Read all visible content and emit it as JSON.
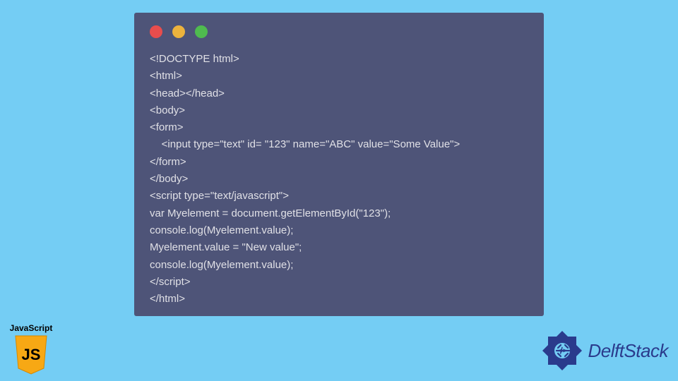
{
  "code_lines": [
    "<!DOCTYPE html>",
    "<html>",
    "<head></head>",
    "<body>",
    "<form>",
    "    <input type=\"text\" id= \"123\" name=\"ABC\" value=\"Some Value\">",
    "</form>",
    "</body>",
    "<script type=\"text/javascript\">",
    "var Myelement = document.getElementById(\"123\");",
    "console.log(Myelement.value);",
    "Myelement.value = \"New value\";",
    "console.log(Myelement.value);",
    "</script>",
    "</html>"
  ],
  "js_badge": {
    "label": "JavaScript",
    "logo_text": "JS"
  },
  "delft": {
    "text": "DelftStack"
  },
  "colors": {
    "bg": "#74cdf4",
    "window": "#4e5478",
    "code_text": "#e0e0e6",
    "dot_red": "#e84d4d",
    "dot_yellow": "#edb33d",
    "dot_green": "#4fbb4f",
    "js_yellow": "#f7a814",
    "delft_blue": "#2a3b8c"
  }
}
